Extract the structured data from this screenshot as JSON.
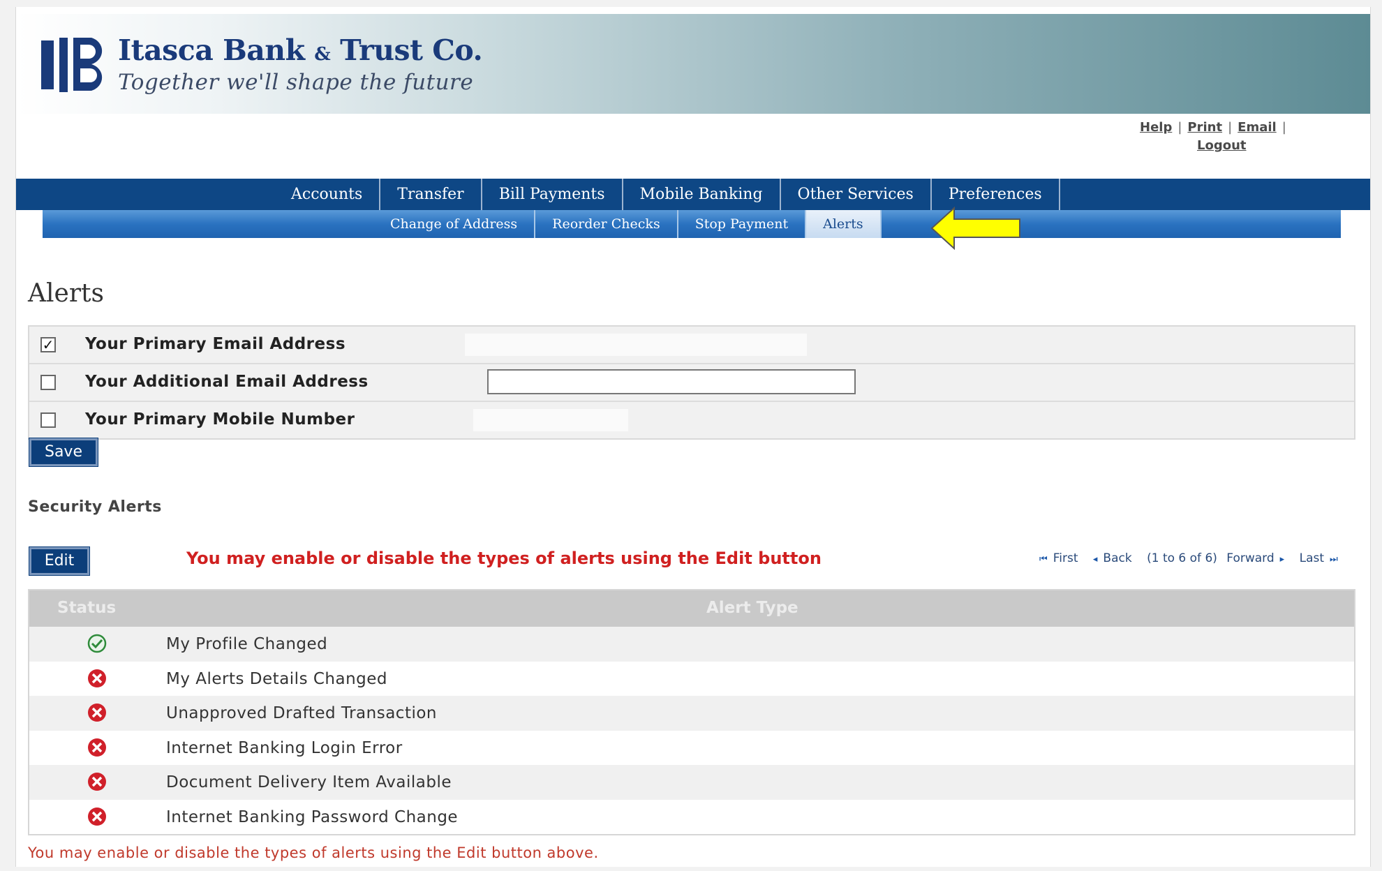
{
  "brand": {
    "name": "Itasca Bank",
    "name_amp": "&",
    "name_end": "Trust Co.",
    "tagline": "Together we'll shape the future"
  },
  "util_links": [
    {
      "label": "Help"
    },
    {
      "label": "Print"
    },
    {
      "label": "Email"
    },
    {
      "label": "Logout"
    }
  ],
  "main_nav": [
    {
      "label": "Accounts"
    },
    {
      "label": "Transfer"
    },
    {
      "label": "Bill Payments"
    },
    {
      "label": "Mobile Banking"
    },
    {
      "label": "Other Services"
    },
    {
      "label": "Preferences"
    }
  ],
  "sub_nav": [
    {
      "label": "Change of Address"
    },
    {
      "label": "Reorder Checks"
    },
    {
      "label": "Stop Payment"
    },
    {
      "label": "Alerts",
      "active": true
    }
  ],
  "page": {
    "title": "Alerts"
  },
  "contacts": [
    {
      "label": "Your Primary Email Address",
      "checked": true,
      "value": ""
    },
    {
      "label": "Your Additional Email Address",
      "checked": false,
      "value": ""
    },
    {
      "label": "Your Primary Mobile Number",
      "checked": false,
      "value": ""
    }
  ],
  "buttons": {
    "save": "Save",
    "edit": "Edit"
  },
  "security": {
    "title": "Security Alerts",
    "edit_hint": "You may enable or disable the types of alerts using the Edit button",
    "pager": {
      "first": "First",
      "back": "Back",
      "range": "(1 to 6 of 6)",
      "forward": "Forward",
      "last": "Last"
    },
    "columns": {
      "status": "Status",
      "type": "Alert Type"
    },
    "rows": [
      {
        "status": "enabled",
        "type": "My Profile Changed"
      },
      {
        "status": "disabled",
        "type": "My Alerts Details Changed"
      },
      {
        "status": "disabled",
        "type": "Unapproved Drafted Transaction"
      },
      {
        "status": "disabled",
        "type": "Internet Banking Login Error"
      },
      {
        "status": "disabled",
        "type": "Document Delivery Item Available"
      },
      {
        "status": "disabled",
        "type": "Internet Banking Password Change"
      }
    ],
    "footer_note": "You may enable or disable the types of alerts using the Edit button above."
  },
  "colors": {
    "nav_dark": "#0e4785",
    "nav_sub": "#2a72c0",
    "brand_text": "#1a3a7a",
    "hint_red": "#d02020",
    "arrow_yellow": "#ffff00",
    "enabled_green": "#2e8b3a",
    "disabled_red": "#d0202a"
  },
  "icons": {
    "enabled": "check-circle-icon",
    "disabled": "x-circle-icon",
    "callout": "yellow-arrow-left-icon"
  }
}
